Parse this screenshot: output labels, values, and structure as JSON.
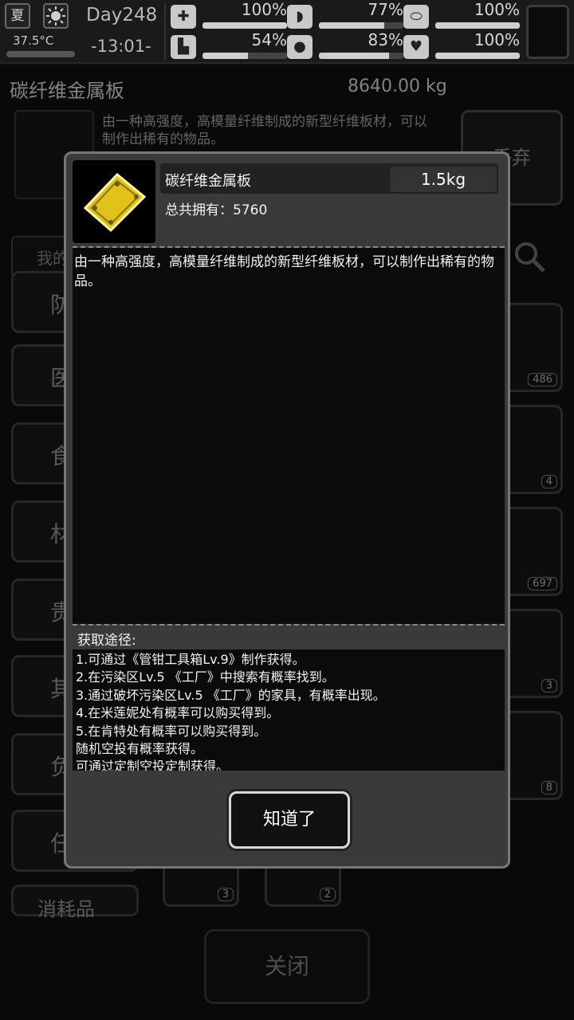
{
  "status": {
    "season": "夏",
    "temperature": "37.5°C",
    "day": "Day248",
    "time": "-13:01-",
    "stats": [
      {
        "name": "health",
        "icon": "medkit-icon",
        "value": "100%",
        "fraction": 1.0
      },
      {
        "name": "hunger",
        "icon": "stomach-icon",
        "value": "77%",
        "fraction": 0.77
      },
      {
        "name": "medicine",
        "icon": "pill-icon",
        "value": "100%",
        "fraction": 1.0
      },
      {
        "name": "stamina",
        "icon": "boot-icon",
        "value": "54%",
        "fraction": 0.54
      },
      {
        "name": "thirst",
        "icon": "water-drop-icon",
        "value": "83%",
        "fraction": 0.83
      },
      {
        "name": "mood",
        "icon": "heart-icon",
        "value": "100%",
        "fraction": 1.0
      }
    ]
  },
  "background": {
    "item_name": "碳纤维金属板",
    "total_weight": "8640.00 kg",
    "description": "由一种高强度，高模量纤维制成的新型纤维板材，可以制作出稀有的物品。",
    "discard_label": "丢弃",
    "search_placeholder": "我的",
    "categories": [
      "防",
      "医",
      "食",
      "材",
      "贵",
      "其",
      "负",
      "任",
      "消耗品"
    ],
    "slot_counts": [
      "486",
      "4",
      "697",
      "3",
      "8",
      "3",
      "2"
    ],
    "close_label": "关闭"
  },
  "dialog": {
    "item_name": "碳纤维金属板",
    "weight": "1.5kg",
    "owned_label": "总共拥有：5760",
    "description": "由一种高强度，高模量纤维制成的新型纤维板材，可以制作出稀有的物品。",
    "source_title": "获取途径:",
    "sources": [
      "1.可通过《管钳工具箱Lv.9》制作获得。",
      "2.在污染区Lv.5 《工厂》中搜索有概率找到。",
      "3.通过破坏污染区Lv.5 《工厂》的家具，有概率出现。",
      "4.在米莲妮处有概率可以购买得到。",
      "5.在肯特处有概率可以购买得到。",
      "随机空投有概率获得。",
      "可通过定制空投定制获得。"
    ],
    "ok_label": "知道了"
  }
}
